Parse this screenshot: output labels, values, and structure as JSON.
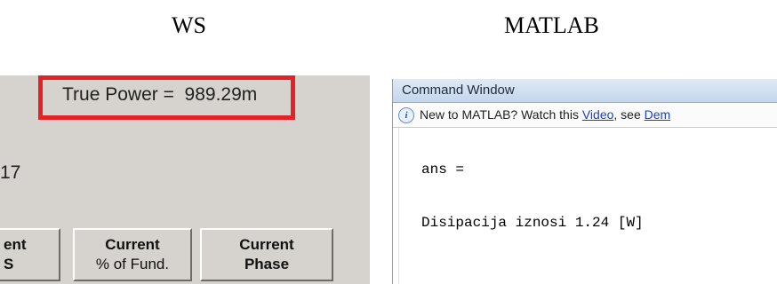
{
  "headings": {
    "ws": "WS",
    "matlab": "MATLAB"
  },
  "ws_panel": {
    "true_power_label": "True Power =",
    "true_power_value": "989.29m",
    "partial_value": "17",
    "columns": [
      {
        "line1": "ent",
        "line2": "S"
      },
      {
        "line1": "Current",
        "line2": "% of Fund."
      },
      {
        "line1": "Current",
        "line2": "Phase"
      }
    ],
    "highlight_color": "#e32227"
  },
  "matlab_panel": {
    "title": "Command Window",
    "info_icon": "info-icon",
    "info_text": "New to MATLAB? Watch this ",
    "info_link1": "Video",
    "info_mid": ", see ",
    "info_link2": "Dem",
    "output_lines": [
      "ans =",
      "Disipacija iznosi 1.24 [W]"
    ]
  }
}
